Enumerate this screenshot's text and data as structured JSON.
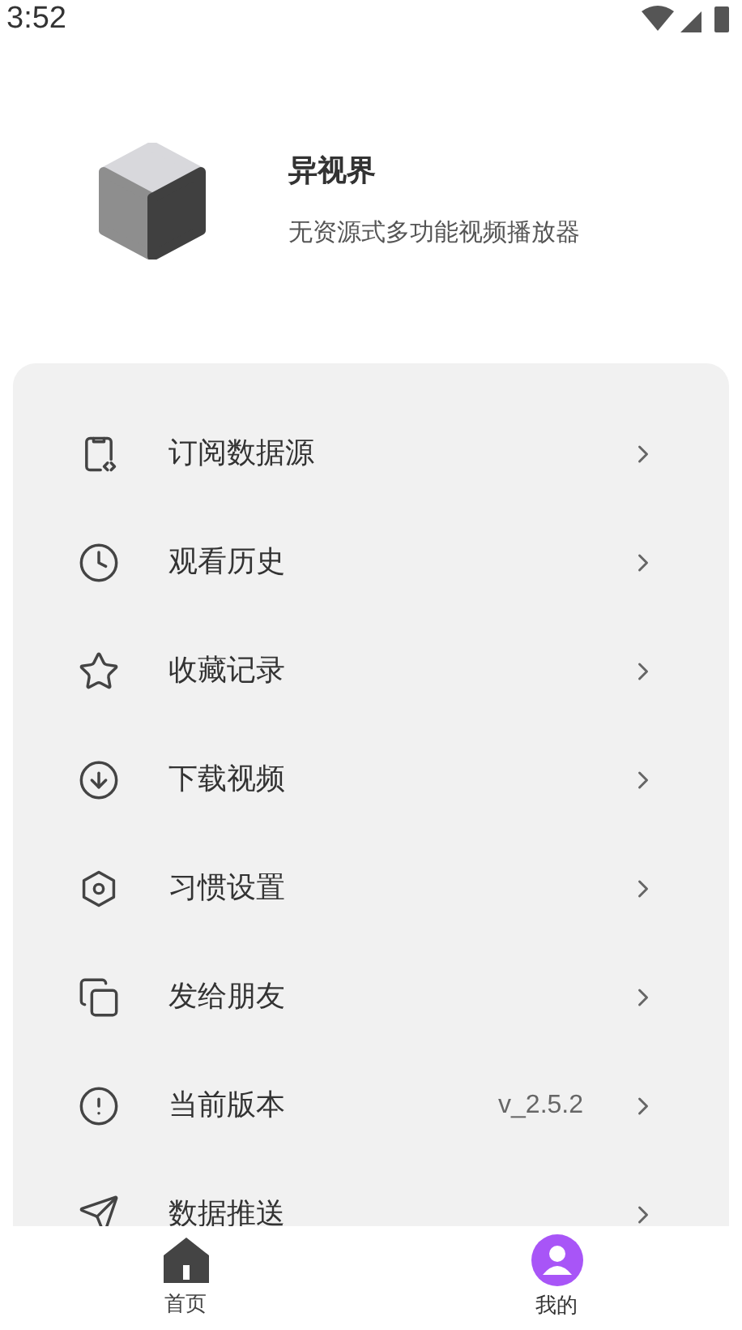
{
  "status_bar": {
    "time": "3:52"
  },
  "header": {
    "title": "异视界",
    "subtitle": "无资源式多功能视频播放器"
  },
  "menu": [
    {
      "label": "订阅数据源"
    },
    {
      "label": "观看历史"
    },
    {
      "label": "收藏记录"
    },
    {
      "label": "下载视频"
    },
    {
      "label": "习惯设置"
    },
    {
      "label": "发给朋友"
    },
    {
      "label": "当前版本",
      "value": "v_2.5.2"
    },
    {
      "label": "数据推送"
    }
  ],
  "bottom_nav": [
    {
      "label": "首页",
      "selected": false
    },
    {
      "label": "我的",
      "selected": true
    }
  ]
}
